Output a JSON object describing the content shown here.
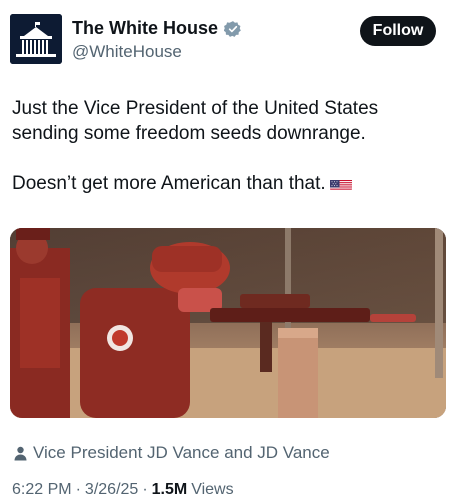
{
  "account": {
    "name": "The White House",
    "handle": "@WhiteHouse",
    "follow_label": "Follow"
  },
  "tweet": {
    "line1": "Just the Vice President of the United States",
    "line2": "sending some freedom seeds downrange.",
    "line3": "Doesn’t get more American than that.",
    "flag_icon": "us-flag-emoji"
  },
  "media": {
    "description_icon": "photo"
  },
  "credit": {
    "text": "Vice President JD Vance and JD Vance",
    "icon": "person-icon"
  },
  "meta": {
    "time": "6:22 PM",
    "sep1": "·",
    "date": "3/26/25",
    "sep2": "·",
    "views_count": "1.5M",
    "views_label": "Views"
  },
  "colors": {
    "text": "#0f1419",
    "secondary": "#536471",
    "verified": "#829aab",
    "follow_bg": "#0f1419"
  }
}
